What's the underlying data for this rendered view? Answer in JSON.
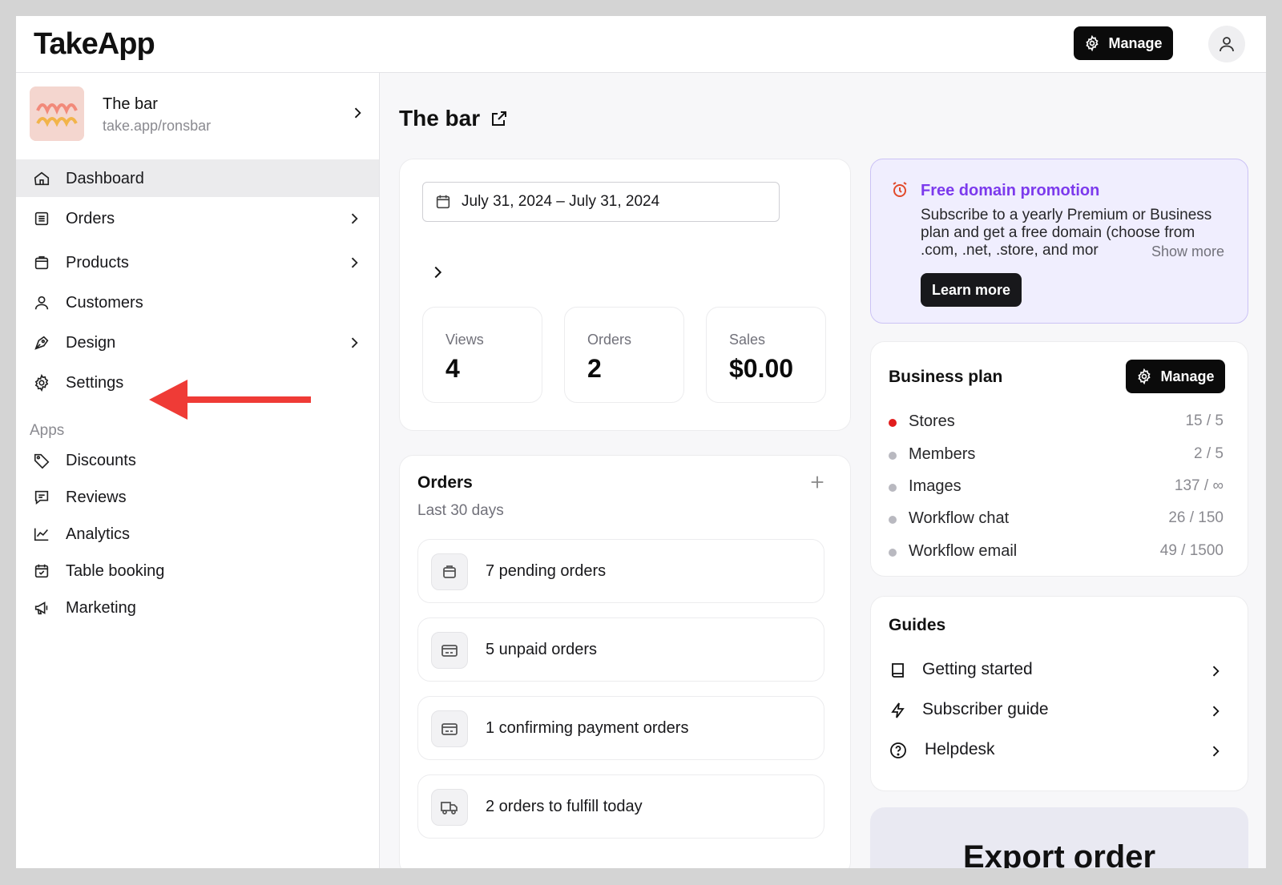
{
  "app": {
    "logo": "TakeApp"
  },
  "header": {
    "manage_label": "Manage"
  },
  "store": {
    "name": "The bar",
    "url": "take.app/ronsbar"
  },
  "sidebar": {
    "items": [
      {
        "label": "Dashboard"
      },
      {
        "label": "Orders"
      },
      {
        "label": "Products"
      },
      {
        "label": "Customers"
      },
      {
        "label": "Design"
      },
      {
        "label": "Settings"
      }
    ],
    "apps_label": "Apps",
    "apps": [
      {
        "label": "Discounts"
      },
      {
        "label": "Reviews"
      },
      {
        "label": "Analytics"
      },
      {
        "label": "Table booking"
      },
      {
        "label": "Marketing"
      }
    ]
  },
  "main": {
    "title": "The bar",
    "date_range": "July 31, 2024 – July 31, 2024",
    "stats": [
      {
        "label": "Views",
        "value": "4"
      },
      {
        "label": "Orders",
        "value": "2"
      },
      {
        "label": "Sales",
        "value": "$0.00"
      }
    ],
    "orders": {
      "title": "Orders",
      "subtitle": "Last 30 days",
      "rows": [
        {
          "label": "7 pending orders"
        },
        {
          "label": "5 unpaid orders"
        },
        {
          "label": "1 confirming payment orders"
        },
        {
          "label": "2 orders to fulfill today"
        }
      ]
    }
  },
  "promo": {
    "title": "Free domain promotion",
    "body": "Subscribe to a yearly Premium or Business plan and get a free domain (choose from .com, .net, .store, and mor",
    "show_more": "Show more",
    "learn_more": "Learn more"
  },
  "plan": {
    "title": "Business plan",
    "manage_label": "Manage",
    "rows": [
      {
        "name": "Stores",
        "value": "15 / 5"
      },
      {
        "name": "Members",
        "value": "2 / 5"
      },
      {
        "name": "Images",
        "value": "137 / ∞"
      },
      {
        "name": "Workflow chat",
        "value": "26 / 150"
      },
      {
        "name": "Workflow email",
        "value": "49 / 1500"
      }
    ]
  },
  "guides": {
    "title": "Guides",
    "items": [
      {
        "label": "Getting started"
      },
      {
        "label": "Subscriber guide"
      },
      {
        "label": "Helpdesk"
      }
    ]
  },
  "export": {
    "title": "Export order"
  },
  "colors": {
    "accent": "#7c3aed",
    "alert_red": "#e11d1d",
    "arrow_red": "#ef3b36",
    "dark": "#0b0b0b"
  }
}
